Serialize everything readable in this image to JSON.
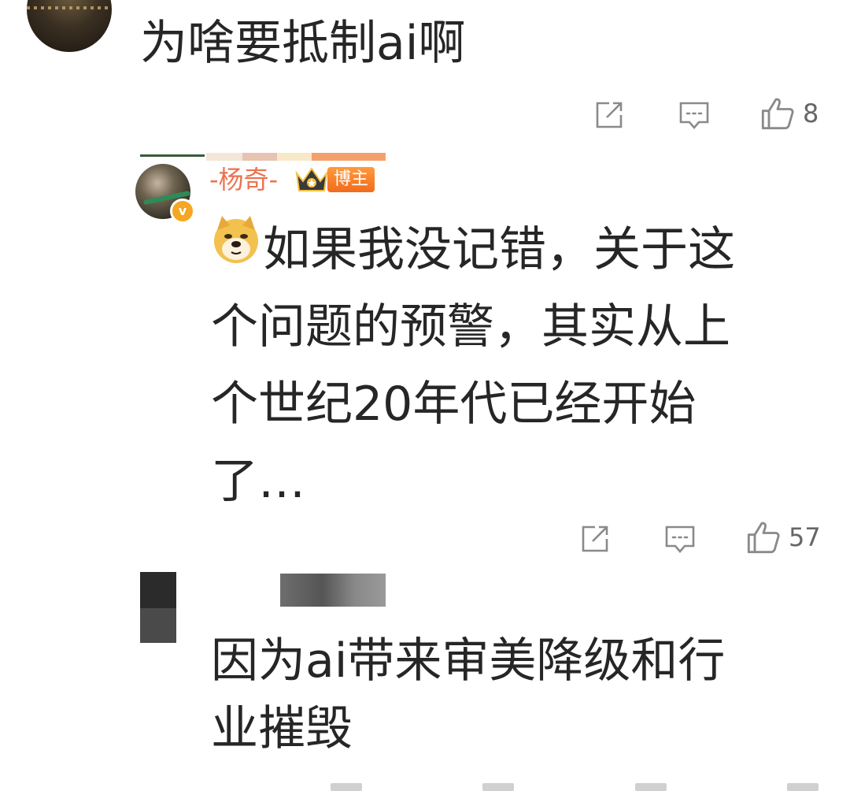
{
  "comments": [
    {
      "text": "为啥要抵制ai啊",
      "actions": {
        "likes": "8"
      },
      "icons": [
        "share-icon",
        "comment-icon",
        "like-icon"
      ]
    },
    {
      "username": "-杨奇-",
      "badge": "博主",
      "emoji": "doge-emoji",
      "lines": [
        "如果我没记错，关于这",
        "个问题的预警，其实从上",
        "个世纪20年代已经开始",
        "了…"
      ],
      "actions": {
        "likes": "57"
      },
      "colors": {
        "username": "#eb7350",
        "badge": "#f26b1d",
        "verified": "#f5a623"
      }
    },
    {
      "lines": [
        "因为ai带来审美降级和行",
        "业摧毁"
      ]
    }
  ]
}
